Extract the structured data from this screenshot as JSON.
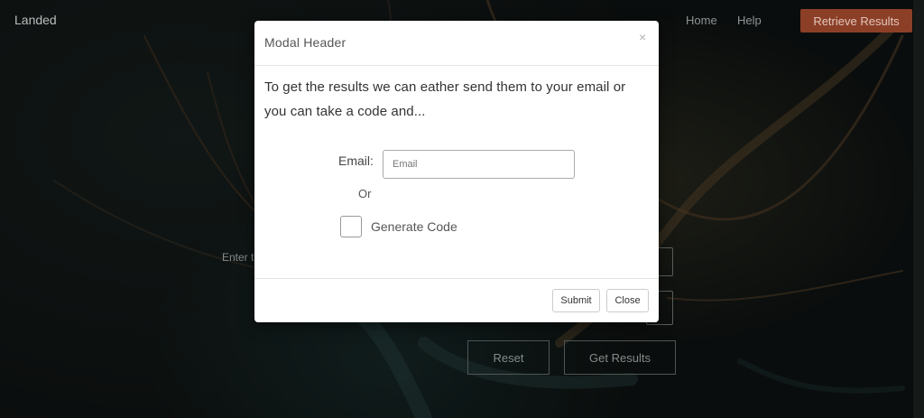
{
  "navbar": {
    "brand": "Landed",
    "links": [
      "Home",
      "Help"
    ],
    "retrieve_button": "Retrieve Results"
  },
  "page": {
    "enter_label": "Enter th",
    "reset_button": "Reset",
    "get_results_button": "Get Results"
  },
  "modal": {
    "title": "Modal Header",
    "close_glyph": "×",
    "body_text": "To get the results we can eather send them to your email or you can take a code and...",
    "email_label": "Email:",
    "email_placeholder": "Email",
    "or_label": "Or",
    "generate_code_label": "Generate Code",
    "generate_code_checked": false,
    "submit_button": "Submit",
    "close_button": "Close"
  },
  "colors": {
    "accent": "#8c3f27",
    "modal_bg": "#ffffff"
  }
}
